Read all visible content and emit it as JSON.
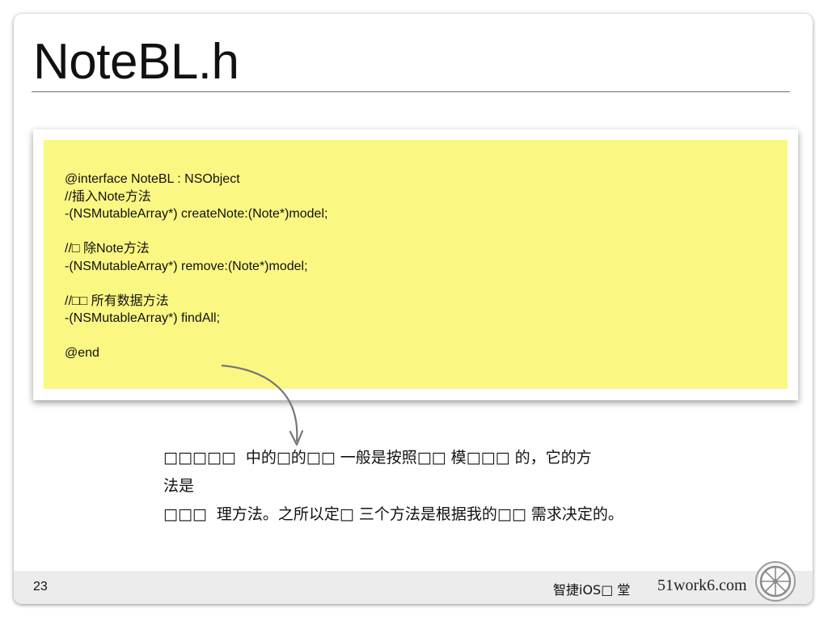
{
  "slide": {
    "title": "NoteBL.h"
  },
  "code": {
    "lines": [
      "@interface NoteBL : NSObject",
      "//插入Note方法",
      "-(NSMutableArray*) createNote:(Note*)model;",
      "",
      "//□ 除Note方法",
      "-(NSMutableArray*) remove:(Note*)model;",
      "",
      "//□□ 所有数据方法",
      "-(NSMutableArray*) findAll;",
      "",
      "@end"
    ]
  },
  "caption": {
    "lines": [
      "□□□□□  中的□的□□ 一般是按照□□ 模□□□ 的，它的方",
      "法是",
      "□□□  理方法。之所以定□ 三个方法是根据我的□□ 需求决定的。"
    ]
  },
  "footer": {
    "page_number": "23",
    "brand_name": "智捷iOS□ 堂",
    "brand_site": "51work6.com"
  },
  "icons": {
    "arrow": "curved-arrow-icon",
    "logo": "wheel-logo-icon"
  },
  "colors": {
    "code_background": "#fbf783",
    "footer_background": "#ececec",
    "text": "#111111"
  }
}
